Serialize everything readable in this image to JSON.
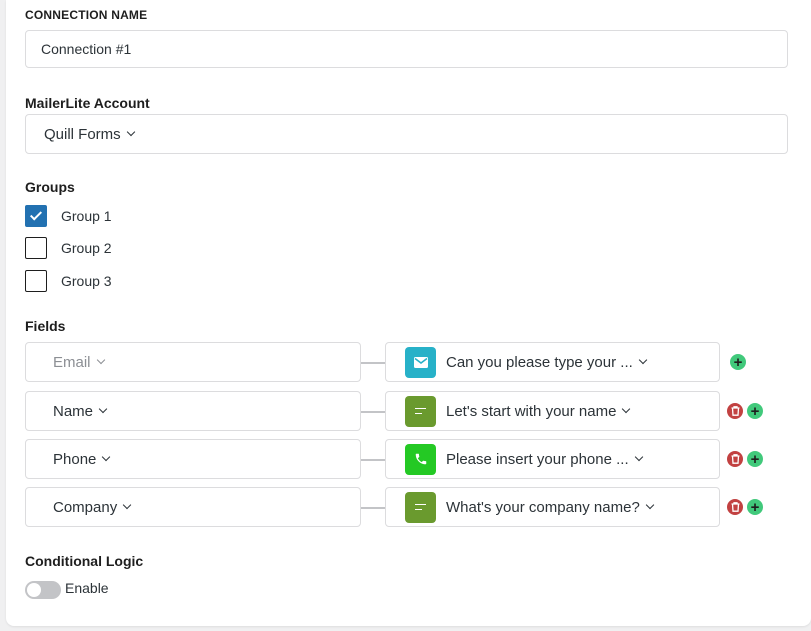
{
  "connection_name": {
    "label": "CONNECTION NAME",
    "value": "Connection #1"
  },
  "account": {
    "label": "MailerLite Account",
    "selected": "Quill Forms"
  },
  "groups": {
    "label": "Groups",
    "items": [
      {
        "label": "Group 1",
        "checked": true
      },
      {
        "label": "Group 2",
        "checked": false
      },
      {
        "label": "Group 3",
        "checked": false
      }
    ]
  },
  "fields": {
    "label": "Fields",
    "rows": [
      {
        "field": "Email",
        "field_muted": true,
        "question": "Can you please type your ...",
        "question_icon": "email-icon",
        "icon_color": "#27b1c8",
        "deletable": false
      },
      {
        "field": "Name",
        "field_muted": false,
        "question": "Let's start with your name",
        "question_icon": "short-text-icon",
        "icon_color": "#6a9a2e",
        "deletable": true
      },
      {
        "field": "Phone",
        "field_muted": false,
        "question": "Please insert your phone ...",
        "question_icon": "phone-icon",
        "icon_color": "#24c924",
        "deletable": true
      },
      {
        "field": "Company",
        "field_muted": false,
        "question": "What's your company name?",
        "question_icon": "short-text-icon",
        "icon_color": "#6a9a2e",
        "deletable": true
      }
    ]
  },
  "conditional_logic": {
    "label": "Conditional Logic",
    "toggle_label": "Enable",
    "enabled": false
  },
  "colors": {
    "accent": "#2271b1",
    "add_button": "#41c97b",
    "delete_button": "#c24141"
  }
}
